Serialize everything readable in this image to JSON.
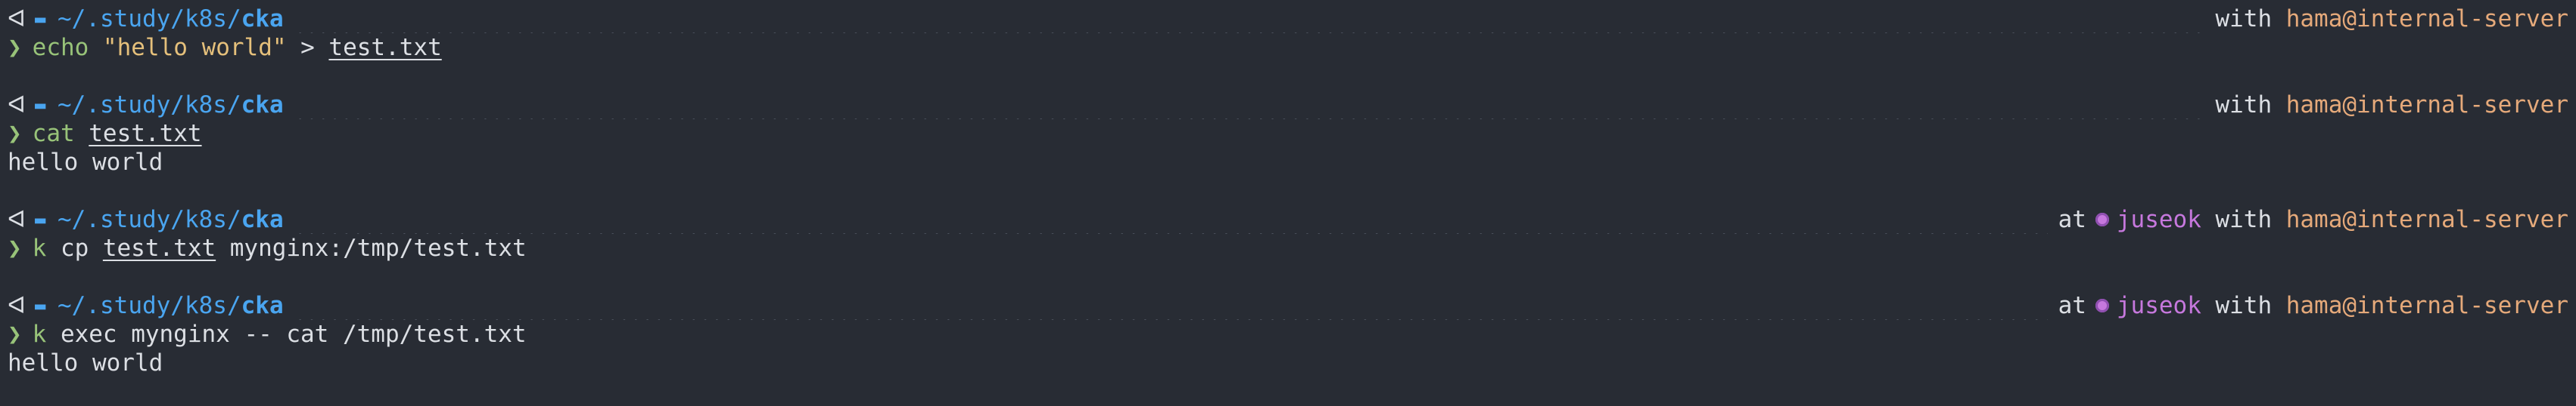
{
  "colors": {
    "background": "#282c34",
    "path": "#4aa5f0",
    "prompt_chevron": "#98c379",
    "command": "#98c379",
    "string": "#e5c07b",
    "user_host": "#e5a97a",
    "kube_context": "#c678dd",
    "dots": "#5c6370"
  },
  "icons": {
    "os": "left-triangle-icon",
    "folder": "folder-icon",
    "prompt": "chevron-right-icon",
    "context": "circle-icon"
  },
  "blocks": [
    {
      "path_prefix": "~/.study/k8s/",
      "path_current": "cka",
      "show_context": false,
      "at_label": "",
      "context": "",
      "with_label": "with",
      "user_host": "hama@internal-server",
      "command_parts": [
        {
          "text": "echo",
          "kind": "cmd"
        },
        {
          "text": "\"hello world\"",
          "kind": "str"
        },
        {
          "text": ">",
          "kind": "arg"
        },
        {
          "text": "test.txt",
          "kind": "file"
        }
      ],
      "output": ""
    },
    {
      "path_prefix": "~/.study/k8s/",
      "path_current": "cka",
      "show_context": false,
      "at_label": "",
      "context": "",
      "with_label": "with",
      "user_host": "hama@internal-server",
      "command_parts": [
        {
          "text": "cat",
          "kind": "cmd"
        },
        {
          "text": "test.txt",
          "kind": "file"
        }
      ],
      "output": "hello world"
    },
    {
      "path_prefix": "~/.study/k8s/",
      "path_current": "cka",
      "show_context": true,
      "at_label": "at",
      "context": "juseok",
      "with_label": "with",
      "user_host": "hama@internal-server",
      "command_parts": [
        {
          "text": "k",
          "kind": "cmd"
        },
        {
          "text": "cp",
          "kind": "arg"
        },
        {
          "text": "test.txt",
          "kind": "file"
        },
        {
          "text": "mynginx:/tmp/test.txt",
          "kind": "arg"
        }
      ],
      "output": ""
    },
    {
      "path_prefix": "~/.study/k8s/",
      "path_current": "cka",
      "show_context": true,
      "at_label": "at",
      "context": "juseok",
      "with_label": "with",
      "user_host": "hama@internal-server",
      "command_parts": [
        {
          "text": "k",
          "kind": "cmd"
        },
        {
          "text": "exec",
          "kind": "arg"
        },
        {
          "text": "mynginx",
          "kind": "arg"
        },
        {
          "text": "--",
          "kind": "arg"
        },
        {
          "text": "cat",
          "kind": "arg"
        },
        {
          "text": "/tmp/test.txt",
          "kind": "arg"
        }
      ],
      "output": "hello world"
    }
  ]
}
